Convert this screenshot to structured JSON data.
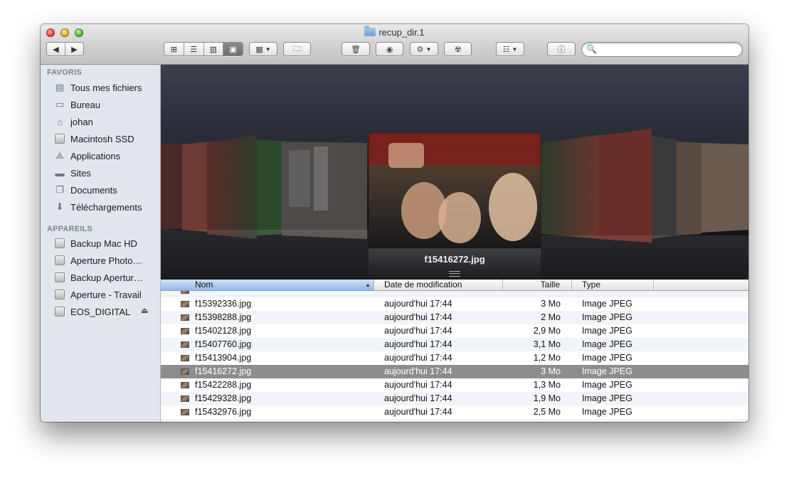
{
  "window": {
    "title": "recup_dir.1"
  },
  "toolbar": {
    "view_buttons": [
      "icon-view",
      "list-view",
      "column-view",
      "coverflow-view"
    ],
    "active_view": 3
  },
  "search": {
    "placeholder": "",
    "value": ""
  },
  "sidebar": {
    "favorites_header": "FAVORIS",
    "favorites": [
      {
        "label": "Tous mes fichiers",
        "icon": "all-files-icon"
      },
      {
        "label": "Bureau",
        "icon": "desktop-icon"
      },
      {
        "label": "johan",
        "icon": "home-icon"
      },
      {
        "label": "Macintosh SSD",
        "icon": "disk-icon"
      },
      {
        "label": "Applications",
        "icon": "applications-icon"
      },
      {
        "label": "Sites",
        "icon": "folder-icon"
      },
      {
        "label": "Documents",
        "icon": "documents-icon"
      },
      {
        "label": "Téléchargements",
        "icon": "downloads-icon"
      }
    ],
    "devices_header": "APPAREILS",
    "devices": [
      {
        "label": "Backup Mac HD",
        "icon": "disk-icon"
      },
      {
        "label": "Aperture Photo…",
        "icon": "disk-icon"
      },
      {
        "label": "Backup Apertur…",
        "icon": "disk-icon"
      },
      {
        "label": "Aperture - Travail",
        "icon": "disk-icon"
      },
      {
        "label": "EOS_DIGITAL",
        "icon": "disk-icon",
        "ejectable": true
      }
    ]
  },
  "coverflow": {
    "caption": "f15416272.jpg"
  },
  "list": {
    "columns": {
      "name": "Nom",
      "date": "Date de modification",
      "size": "Taille",
      "type": "Type"
    },
    "rows": [
      {
        "name": "f15392336.jpg",
        "date": "aujourd'hui 17:44",
        "size": "3 Mo",
        "type": "Image JPEG"
      },
      {
        "name": "f15398288.jpg",
        "date": "aujourd'hui 17:44",
        "size": "2 Mo",
        "type": "Image JPEG"
      },
      {
        "name": "f15402128.jpg",
        "date": "aujourd'hui 17:44",
        "size": "2,9 Mo",
        "type": "Image JPEG"
      },
      {
        "name": "f15407760.jpg",
        "date": "aujourd'hui 17:44",
        "size": "3,1 Mo",
        "type": "Image JPEG"
      },
      {
        "name": "f15413904.jpg",
        "date": "aujourd'hui 17:44",
        "size": "1,2 Mo",
        "type": "Image JPEG"
      },
      {
        "name": "f15416272.jpg",
        "date": "aujourd'hui 17:44",
        "size": "3 Mo",
        "type": "Image JPEG",
        "selected": true
      },
      {
        "name": "f15422288.jpg",
        "date": "aujourd'hui 17:44",
        "size": "1,3 Mo",
        "type": "Image JPEG"
      },
      {
        "name": "f15429328.jpg",
        "date": "aujourd'hui 17:44",
        "size": "1,9 Mo",
        "type": "Image JPEG"
      },
      {
        "name": "f15432976.jpg",
        "date": "aujourd'hui 17:44",
        "size": "2,5 Mo",
        "type": "Image JPEG"
      }
    ]
  }
}
